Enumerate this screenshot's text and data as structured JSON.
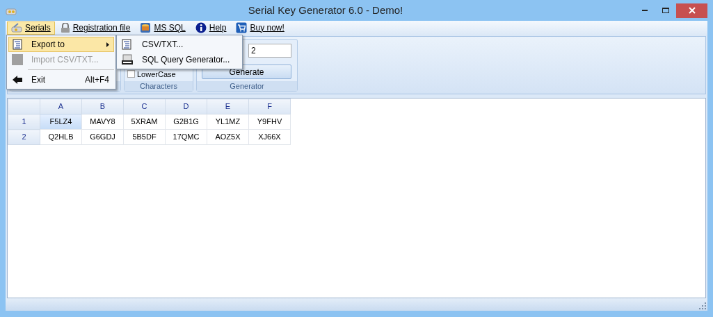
{
  "window": {
    "title": "Serial Key Generator 6.0 - Demo!"
  },
  "menu_bar": [
    {
      "label": "Serials",
      "selected": true
    },
    {
      "label": "Registration file",
      "selected": false
    },
    {
      "label": "MS SQL",
      "selected": false
    },
    {
      "label": "Help",
      "selected": false
    },
    {
      "label": "Buy now!",
      "selected": false
    }
  ],
  "ribbon": {
    "groups": [
      {
        "label": "Characters"
      },
      {
        "label": "Generator"
      }
    ],
    "lowercase": {
      "label": "LowerCase",
      "checked": false
    },
    "count_field": {
      "value": "2"
    },
    "generate_button": "Generate"
  },
  "serials_menu": [
    {
      "label": "Export to",
      "selected": true,
      "disabled": false,
      "has_submenu": true
    },
    {
      "label": "Import CSV/TXT...",
      "selected": false,
      "disabled": true,
      "has_submenu": false
    },
    {
      "label": "Exit",
      "shortcut": "Alt+F4",
      "selected": false,
      "disabled": false,
      "has_submenu": false
    }
  ],
  "export_submenu": [
    {
      "label": "CSV/TXT..."
    },
    {
      "label": "SQL Query Generator..."
    }
  ],
  "table": {
    "columns": [
      "A",
      "B",
      "C",
      "D",
      "E",
      "F"
    ],
    "rows": [
      {
        "header": "1",
        "cells": [
          {
            "text": "F5LZ4",
            "selected": true
          },
          {
            "text": "MAVY8",
            "selected": false
          },
          {
            "text": "5XRAM",
            "selected": false
          },
          {
            "text": "G2B1G",
            "selected": false
          },
          {
            "text": "YL1MZ",
            "selected": false
          },
          {
            "text": "Y9FHV",
            "selected": false
          }
        ]
      },
      {
        "header": "2",
        "cells": [
          {
            "text": "Q2HLB",
            "selected": false
          },
          {
            "text": "G6GDJ",
            "selected": false
          },
          {
            "text": "5B5DF",
            "selected": false
          },
          {
            "text": "17QMC",
            "selected": false
          },
          {
            "text": "AOZ5X",
            "selected": false
          },
          {
            "text": "XJ66X",
            "selected": false
          }
        ]
      }
    ]
  }
}
